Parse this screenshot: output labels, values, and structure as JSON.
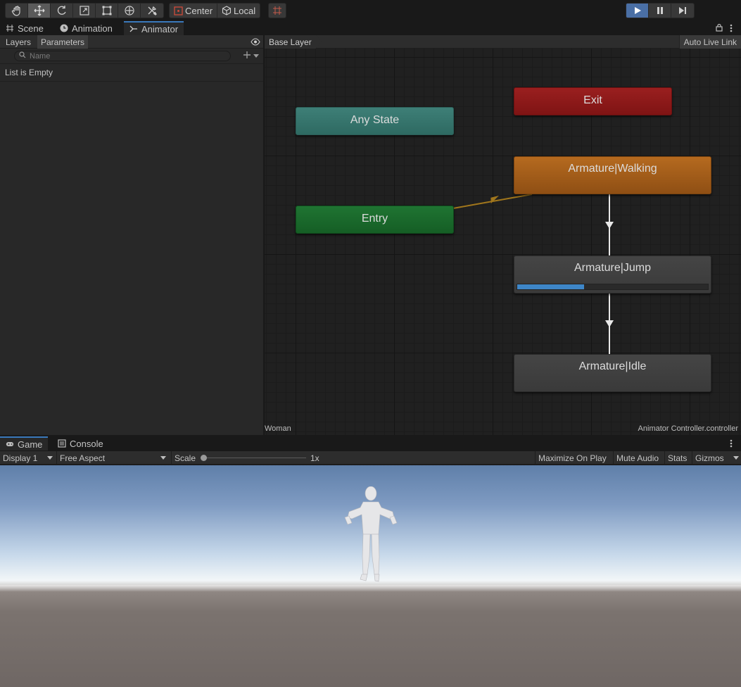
{
  "toolbar": {
    "tools": [
      {
        "name": "hand-tool",
        "icon": "hand-icon"
      },
      {
        "name": "move-tool",
        "icon": "move-icon",
        "active": true
      },
      {
        "name": "rotate-tool",
        "icon": "rotate-icon"
      },
      {
        "name": "scale-tool",
        "icon": "scale-icon"
      },
      {
        "name": "rect-tool",
        "icon": "rect-transform-icon"
      },
      {
        "name": "transform-tool",
        "icon": "transform-icon"
      },
      {
        "name": "custom-tool",
        "icon": "tools-icon"
      }
    ],
    "pivot_label": "Center",
    "space_label": "Local",
    "play_active": true
  },
  "tabs": {
    "scene": "Scene",
    "animation": "Animation",
    "animator": "Animator"
  },
  "left_panel": {
    "tab_layers": "Layers",
    "tab_parameters": "Parameters",
    "search_placeholder": "Name",
    "empty_text": "List is Empty"
  },
  "graph": {
    "breadcrumb": "Base Layer",
    "live_link": "Auto Live Link",
    "footer_left": "Woman",
    "footer_right": "Animator Controller.controller",
    "states": {
      "any_state": "Any State",
      "exit": "Exit",
      "entry": "Entry",
      "walking": "Armature|Walking",
      "jump": "Armature|Jump",
      "idle": "Armature|Idle"
    },
    "jump_progress": 0.35,
    "colors": {
      "any_state": "#3e7f77",
      "exit": "#9a1f1f",
      "entry": "#1f7432",
      "default_state": "#b56a1f",
      "transition_default": "#a0761c",
      "progress": "#3e86c8"
    }
  },
  "game": {
    "tab_game": "Game",
    "tab_console": "Console",
    "display": "Display 1",
    "aspect": "Free Aspect",
    "scale_label": "Scale",
    "scale_value": "1x",
    "maximize": "Maximize On Play",
    "mute": "Mute Audio",
    "stats": "Stats",
    "gizmos": "Gizmos"
  }
}
